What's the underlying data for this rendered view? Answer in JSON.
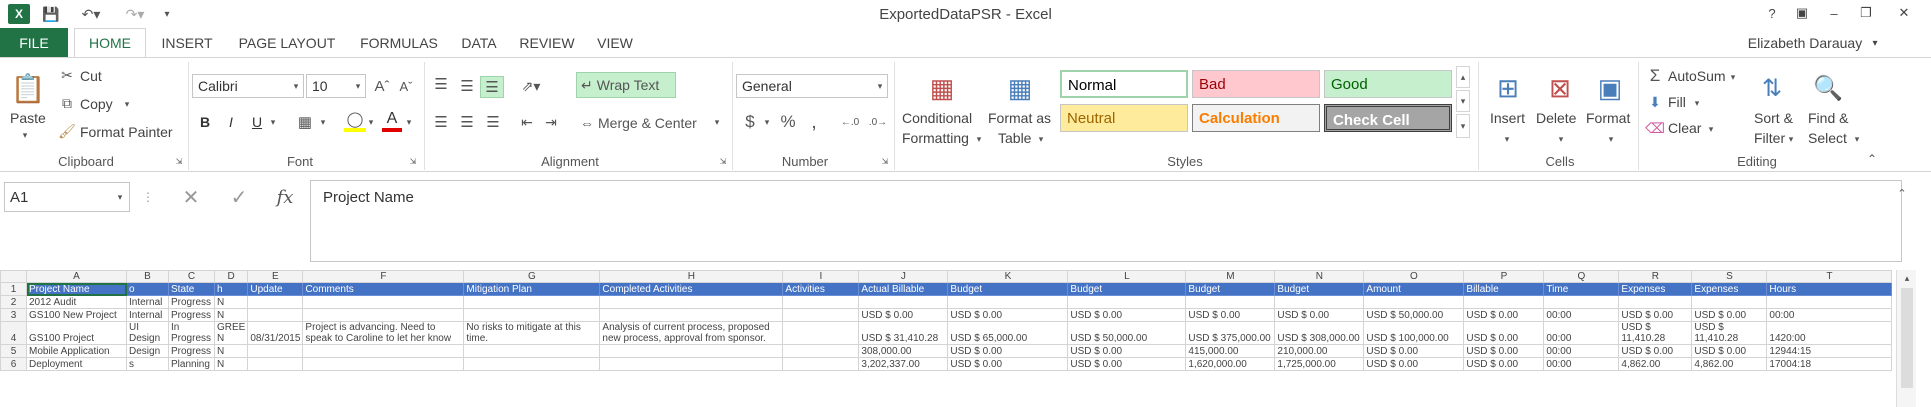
{
  "window": {
    "title": "ExportedDataPSR - Excel",
    "help": "?",
    "user": "Elizabeth Darauay"
  },
  "tabs": [
    "FILE",
    "HOME",
    "INSERT",
    "PAGE LAYOUT",
    "FORMULAS",
    "DATA",
    "REVIEW",
    "VIEW"
  ],
  "ribbon": {
    "clipboard": {
      "label": "Clipboard",
      "paste": "Paste",
      "cut": "Cut",
      "copy": "Copy",
      "format_painter": "Format Painter"
    },
    "font": {
      "label": "Font",
      "name": "Calibri",
      "size": "10",
      "bold": "B",
      "italic": "I",
      "underline": "U"
    },
    "alignment": {
      "label": "Alignment",
      "wrap": "Wrap Text",
      "merge": "Merge & Center"
    },
    "number": {
      "label": "Number",
      "format": "General",
      "currency": "$",
      "percent": "%",
      "comma": ","
    },
    "styles": {
      "label": "Styles",
      "cond1": "Conditional",
      "cond2": "Formatting",
      "fmt1": "Format as",
      "fmt2": "Table",
      "normal": "Normal",
      "bad": "Bad",
      "good": "Good",
      "neutral": "Neutral",
      "calculation": "Calculation",
      "check": "Check Cell"
    },
    "cells": {
      "label": "Cells",
      "insert": "Insert",
      "delete": "Delete",
      "format": "Format"
    },
    "editing": {
      "label": "Editing",
      "autosum": "AutoSum",
      "fill": "Fill",
      "clear": "Clear",
      "sort1": "Sort &",
      "sort2": "Filter",
      "find1": "Find &",
      "find2": "Select"
    }
  },
  "formula_bar": {
    "name_box": "A1",
    "fx": "fx",
    "value": "Project Name"
  },
  "sheet": {
    "columns": [
      "A",
      "B",
      "C",
      "D",
      "E",
      "F",
      "G",
      "H",
      "I",
      "J",
      "K",
      "L",
      "M",
      "N",
      "O",
      "P",
      "Q",
      "R",
      "S",
      "T"
    ],
    "rows": [
      {
        "n": "1",
        "cells": [
          "Project Name",
          "o",
          "State",
          "h",
          "Update",
          "Comments",
          "Mitigation Plan",
          "Completed Activities",
          "Activities",
          "Actual Billable",
          "Budget",
          "Budget",
          "Budget",
          "Budget",
          "Amount",
          "Billable",
          "Time",
          "Expenses",
          "Expenses",
          "Hours"
        ]
      },
      {
        "n": "2",
        "cells": [
          "2012 Audit",
          "Internal",
          "Progress",
          "N",
          "",
          "",
          "",
          "",
          "",
          "",
          "",
          "",
          "",
          "",
          "",
          "",
          "",
          "",
          "",
          ""
        ]
      },
      {
        "n": "3",
        "cells": [
          "GS100 New Project",
          "Internal",
          "Progress",
          "N",
          "",
          "",
          "",
          "",
          "",
          "USD $ 0.00",
          "USD $ 0.00",
          "USD $ 0.00",
          "USD $ 0.00",
          "USD $ 0.00",
          "USD $ 50,000.00",
          "USD $ 0.00",
          "00:00",
          "USD $ 0.00",
          "USD $ 0.00",
          "00:00"
        ]
      },
      {
        "n": "4",
        "cells": [
          "GS100 Project",
          "UI Design",
          "In Progress",
          "GREE N",
          "08/31/2015",
          "Project is advancing. Need to speak to Caroline to let her know",
          "No risks to mitigate at this time.",
          "Analysis of current process, proposed new process, approval from sponsor.",
          "",
          "USD $ 31,410.28",
          "USD $ 65,000.00",
          "USD $ 50,000.00",
          "USD $ 375,000.00",
          "USD $ 308,000.00",
          "USD $ 100,000.00",
          "USD $ 0.00",
          "00:00",
          "USD $ 11,410.28",
          "USD $ 11,410.28",
          "1420:00"
        ]
      },
      {
        "n": "5",
        "cells": [
          "Mobile Application",
          "Design",
          "Progress",
          "N",
          "",
          "",
          "",
          "",
          "",
          "308,000.00",
          "USD $ 0.00",
          "USD $ 0.00",
          "415,000.00",
          "210,000.00",
          "USD $ 0.00",
          "USD $ 0.00",
          "00:00",
          "USD $ 0.00",
          "USD $ 0.00",
          "12944:15"
        ]
      },
      {
        "n": "6",
        "cells": [
          "Deployment",
          "s",
          "Planning",
          "N",
          "",
          "",
          "",
          "",
          "",
          "3,202,337.00",
          "USD $ 0.00",
          "USD $ 0.00",
          "1,620,000.00",
          "1,725,000.00",
          "USD $ 0.00",
          "USD $ 0.00",
          "00:00",
          "4,862.00",
          "4,862.00",
          "17004:18"
        ]
      }
    ]
  }
}
